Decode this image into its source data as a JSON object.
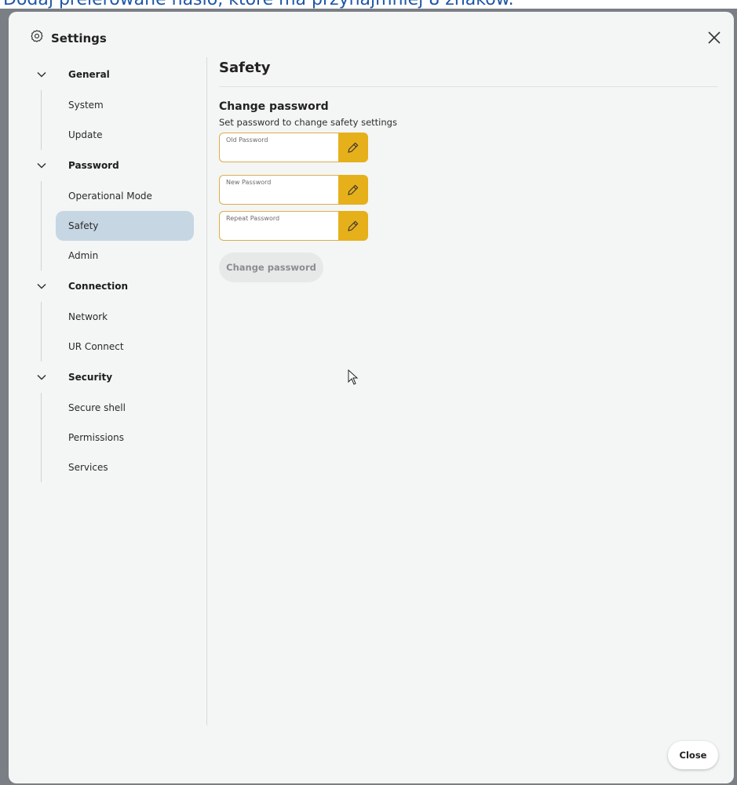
{
  "instruction": "Dodaj prelerowane hasło, które ma przynajmniej 8 znaków.",
  "dialog": {
    "title": "Settings",
    "close_label": "Close"
  },
  "nav": {
    "groups": [
      {
        "label": "General",
        "items": [
          "System",
          "Update"
        ]
      },
      {
        "label": "Password",
        "items": [
          "Operational Mode",
          "Safety",
          "Admin"
        ]
      },
      {
        "label": "Connection",
        "items": [
          "Network",
          "UR Connect"
        ]
      },
      {
        "label": "Security",
        "items": [
          "Secure shell",
          "Permissions",
          "Services"
        ]
      }
    ],
    "active_item": "Safety"
  },
  "content": {
    "page_title": "Safety",
    "section_title": "Change password",
    "section_desc": "Set password to change safety settings",
    "fields": {
      "old_password": "Old Password",
      "new_password": "New Password",
      "repeat_password": "Repeat Password"
    },
    "change_button": "Change password"
  },
  "colors": {
    "accent": "#e6b01a",
    "active_nav": "#c7d6e3",
    "field_border": "#d9b04a",
    "instruction": "#1f57a6"
  }
}
